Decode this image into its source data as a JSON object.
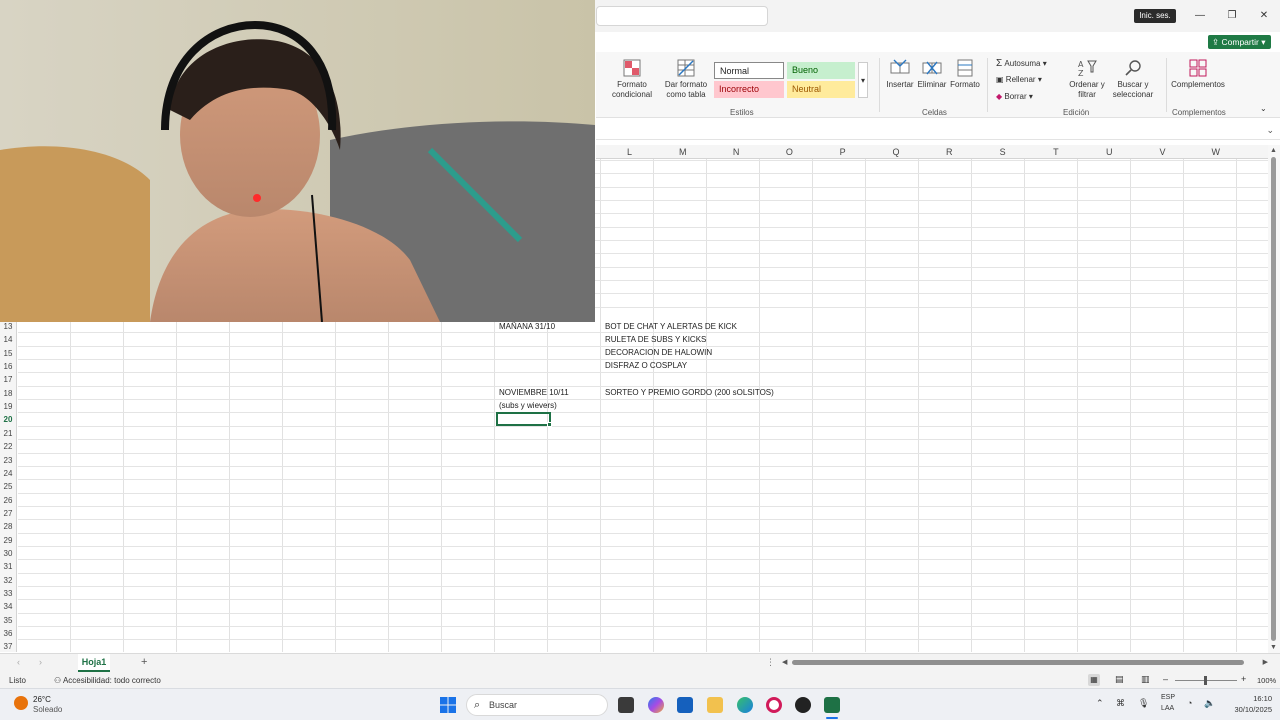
{
  "window": {
    "signin_label": "Inic. ses.",
    "share_label": "Compartir",
    "minimize_glyph": "—",
    "maximize_glyph": "❐",
    "close_glyph": "✕"
  },
  "ribbon": {
    "styles": {
      "conditional_format": "Formato condicional",
      "format_as_table": "Dar formato como tabla",
      "normal": "Normal",
      "good": "Bueno",
      "bad": "Incorrecto",
      "neutral": "Neutral",
      "group_label": "Estilos",
      "colors": {
        "good_bg": "#c6efce",
        "good_fg": "#006100",
        "bad_bg": "#ffc7ce",
        "bad_fg": "#9c0006",
        "neutral_bg": "#ffeb9c",
        "neutral_fg": "#9c5700"
      }
    },
    "cells": {
      "insert": "Insertar",
      "delete": "Eliminar",
      "format": "Formato",
      "group_label": "Celdas"
    },
    "editing": {
      "autosum": "Autosuma",
      "fill": "Rellenar",
      "clear": "Borrar",
      "sort_filter": "Ordenar y filtrar",
      "find_select": "Buscar y seleccionar",
      "group_label": "Edición"
    },
    "addins": {
      "label": "Complementos",
      "group_label": "Complementos"
    }
  },
  "columns": [
    "L",
    "M",
    "N",
    "O",
    "P",
    "Q",
    "R",
    "S",
    "T",
    "U",
    "V",
    "W"
  ],
  "rows": [
    "13",
    "14",
    "15",
    "16",
    "17",
    "18",
    "19",
    "20",
    "21",
    "22",
    "23",
    "24",
    "25",
    "26",
    "27",
    "28",
    "29",
    "30",
    "31",
    "32",
    "33",
    "34",
    "35",
    "36",
    "37"
  ],
  "active_row": "20",
  "cells": {
    "r13_date": "MAÑANA 31/10",
    "r13_item": "BOT DE CHAT Y ALERTAS DE KICK",
    "r14_item": "RULETA DE SUBS Y KICKS",
    "r15_item": "DECORACION DE HALOWIN",
    "r16_item": "DISFRAZ O COSPLAY",
    "r18_date": "NOVIEMBRE 10/11",
    "r18_item": "SORTEO Y PREMIO GORDO (200 sOLSITOS)",
    "r19_note": "(subs y wievers)"
  },
  "sheets": {
    "active_tab": "Hoja1",
    "add_glyph": "+"
  },
  "status": {
    "ready": "Listo",
    "accessibility": "Accesibilidad: todo correcto",
    "zoom": "100%"
  },
  "taskbar": {
    "weather_temp": "26°C",
    "weather_desc": "Soleado",
    "search_placeholder": "Buscar",
    "lang_primary": "ESP",
    "lang_secondary": "LAA",
    "time": "16:10",
    "date": "30/10/2025"
  }
}
